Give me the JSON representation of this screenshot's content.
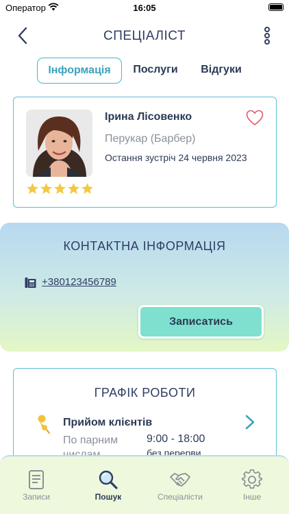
{
  "status_bar": {
    "carrier": "Оператор",
    "time": "16:05"
  },
  "header": {
    "title": "СПЕЦІАЛІСТ",
    "back_icon": "chevron-left-icon",
    "more_icon": "more-vertical-icon"
  },
  "tabs": [
    {
      "label": "Інформація",
      "active": true
    },
    {
      "label": "Послуги",
      "active": false
    },
    {
      "label": "Відгуки",
      "active": false
    }
  ],
  "specialist": {
    "name": "Ірина Лісовенко",
    "role": "Перукар (Барбер)",
    "last_meeting": "Остання зустріч 24 червня 2023",
    "rating": 5,
    "favorite": false
  },
  "contact": {
    "title": "КОНТАКТНА ІНФОРМАЦІЯ",
    "phone": "+380123456789",
    "book_label": "Записатись"
  },
  "schedule": {
    "title": "ГРАФІК РОБОТИ",
    "heading": "Прийом клієнтів",
    "days": "По парним числам",
    "time": "9:00 - 18:00",
    "break": "без перерви"
  },
  "bottom_nav": [
    {
      "label": "Записи",
      "icon": "document-icon",
      "active": false
    },
    {
      "label": "Пошук",
      "icon": "search-icon",
      "active": true
    },
    {
      "label": "Спеціалісти",
      "icon": "handshake-icon",
      "active": false
    },
    {
      "label": "Інше",
      "icon": "gear-icon",
      "active": false
    }
  ],
  "colors": {
    "accent": "#4ab3c8",
    "button": "#7fe0cf",
    "text": "#2b3a55",
    "muted": "#8a909b",
    "star": "#f5c842",
    "heart": "#e05a6a"
  }
}
